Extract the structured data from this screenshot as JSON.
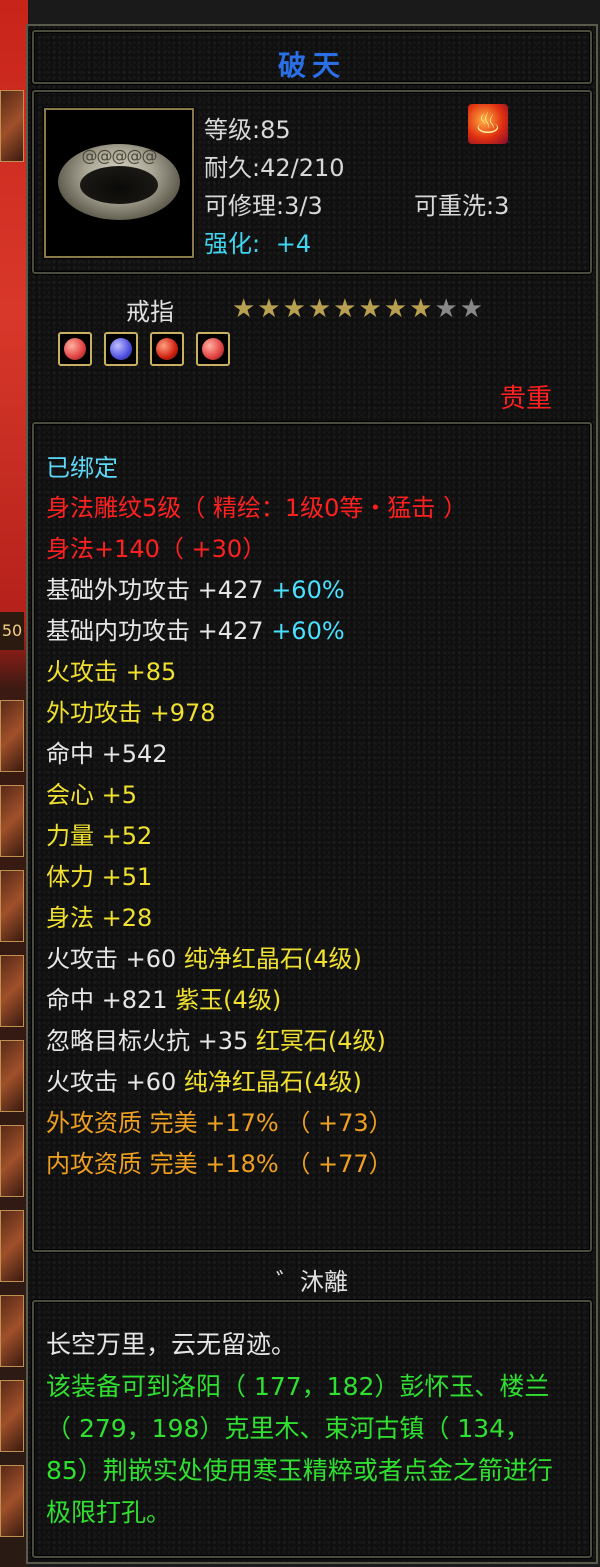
{
  "left_strip": {
    "number": "50"
  },
  "item": {
    "name": "破天",
    "level": "等级:85",
    "durability": "耐久:42/210",
    "repairable": "可修理:3/3",
    "rewashable": "可重洗:3",
    "enhance_label": "强化:",
    "enhance_value": "+4",
    "type": "戒指",
    "stars_on": "★★★★★★★★",
    "stars_off": "★★",
    "quality": "贵重",
    "icons": [
      "ring-icon",
      "fire-element-icon"
    ],
    "gems": [
      {
        "name": "red-gem-icon",
        "color": "#e04040"
      },
      {
        "name": "purple-gem-icon",
        "color": "#5050e0"
      },
      {
        "name": "red-crystal-icon",
        "color": "#d02010"
      },
      {
        "name": "red-gem-icon",
        "color": "#e04040"
      }
    ]
  },
  "attributes": {
    "bound": "已绑定",
    "engrave": "身法雕纹5级（ 精绘：1级0等・猛击 ）",
    "agility_bonus": "身法+140（ +30）",
    "base_ext_atk": "基础外功攻击 +427",
    "base_ext_atk_pct": "+60%",
    "base_int_atk": "基础内功攻击 +427",
    "base_int_atk_pct": "+60%",
    "fire_atk": "火攻击  +85",
    "ext_atk": "外功攻击  +978",
    "hit": "命中  +542",
    "crit": "会心  +5",
    "strength": "力量  +52",
    "stamina": "体力  +51",
    "agility": "身法  +28",
    "gem1_stat": "火攻击  +60",
    "gem1_name": "纯净红晶石(4级)",
    "gem2_stat": "命中  +821",
    "gem2_name": "紫玉(4级)",
    "gem3_stat": "忽略目标火抗  +35",
    "gem3_name": "红冥石(4级)",
    "gem4_stat": "火攻击  +60",
    "gem4_name": "纯净红晶石(4级)",
    "quality1": "外攻资质   完美  +17%  （ +73）",
    "quality2": "内攻资质   完美  +18%  （ +77）"
  },
  "maker": "゛沐離",
  "description": {
    "flavor": "长空万里，云无留迹。",
    "hint": "该装备可到洛阳（ 177，182）彭怀玉、楼兰（ 279，198）克里木、束河古镇（ 134，85）荆嵌实处使用寒玉精粹或者点金之箭进行极限打孔。"
  },
  "colors": {
    "title": "#2b6fe6",
    "enhance": "#3fd4f0",
    "precious": "#ff2020",
    "gem_border": "#c8b060"
  }
}
